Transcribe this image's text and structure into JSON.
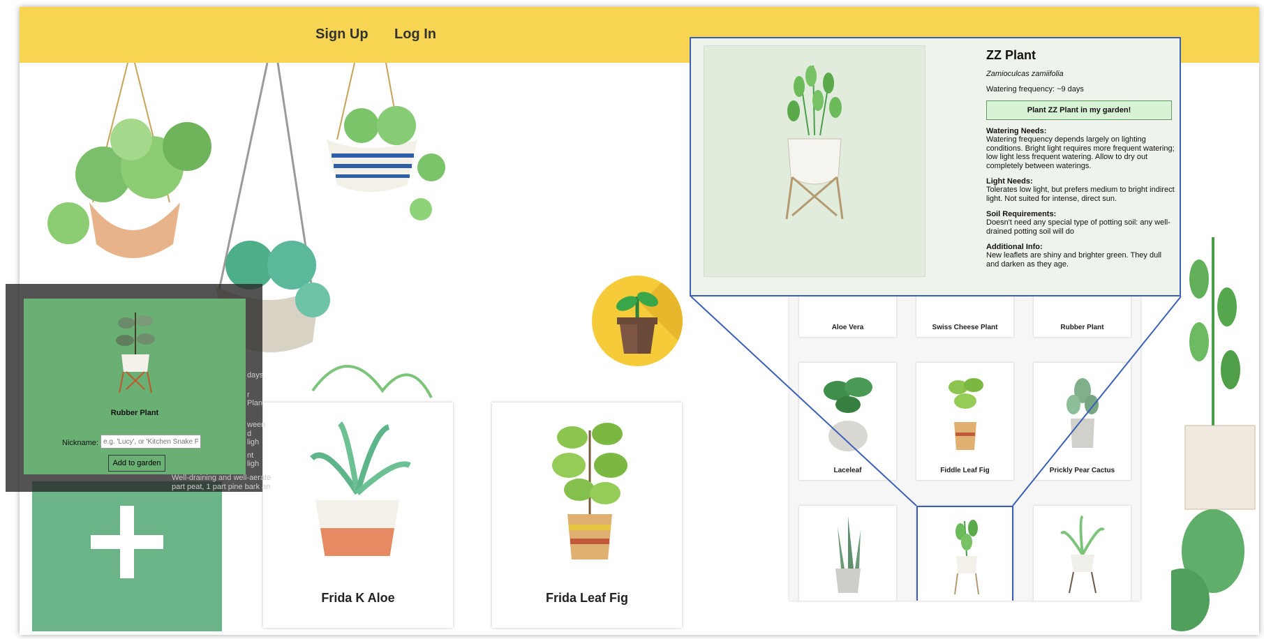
{
  "nav": {
    "signup": "Sign Up",
    "login": "Log In"
  },
  "cards": [
    {
      "name": "Frida K Aloe"
    },
    {
      "name": "Frida Leaf Fig"
    }
  ],
  "modal": {
    "plant_name": "Rubber Plant",
    "nickname_label": "Nickname:",
    "nickname_placeholder": "e.g. 'Lucy', or 'Kitchen Snake P",
    "add_button": "Add to garden",
    "background_fragments": [
      "days",
      "r Plan",
      "ween",
      "d ligh",
      "nt ligh",
      "Well-draining and well-aerate",
      "part peat, 1 part pine bark an"
    ]
  },
  "grid": {
    "row1": [
      "Aloe Vera",
      "Swiss Cheese Plant",
      "Rubber Plant"
    ],
    "row2": [
      "Laceleaf",
      "Fiddle Leaf Fig",
      "Prickly Pear Cactus"
    ]
  },
  "detail": {
    "title": "ZZ Plant",
    "scientific": "Zamioculcas zamiifolia",
    "frequency": "Watering frequency: ~9 days",
    "button": "Plant ZZ Plant in my garden!",
    "watering_h": "Watering Needs:",
    "watering": "Watering frequency depends largely on lighting conditions. Bright light requires more frequent watering; low light less frequent watering. Allow to dry out completely between waterings.",
    "light_h": "Light Needs:",
    "light": "Tolerates low light, but prefers medium to bright indirect light. Not suited for intense, direct sun.",
    "soil_h": "Soil Requirements:",
    "soil": "Doesn't need any special type of potting soil: any well-drained potting soil will do",
    "info_h": "Additional Info:",
    "info": "New leaflets are shiny and brighter green. They dull and darken as they age."
  },
  "colors": {
    "header": "#f7d553",
    "add_card": "#6ab488",
    "modal": "#6aaf74",
    "highlight": "#3b5fb8"
  }
}
